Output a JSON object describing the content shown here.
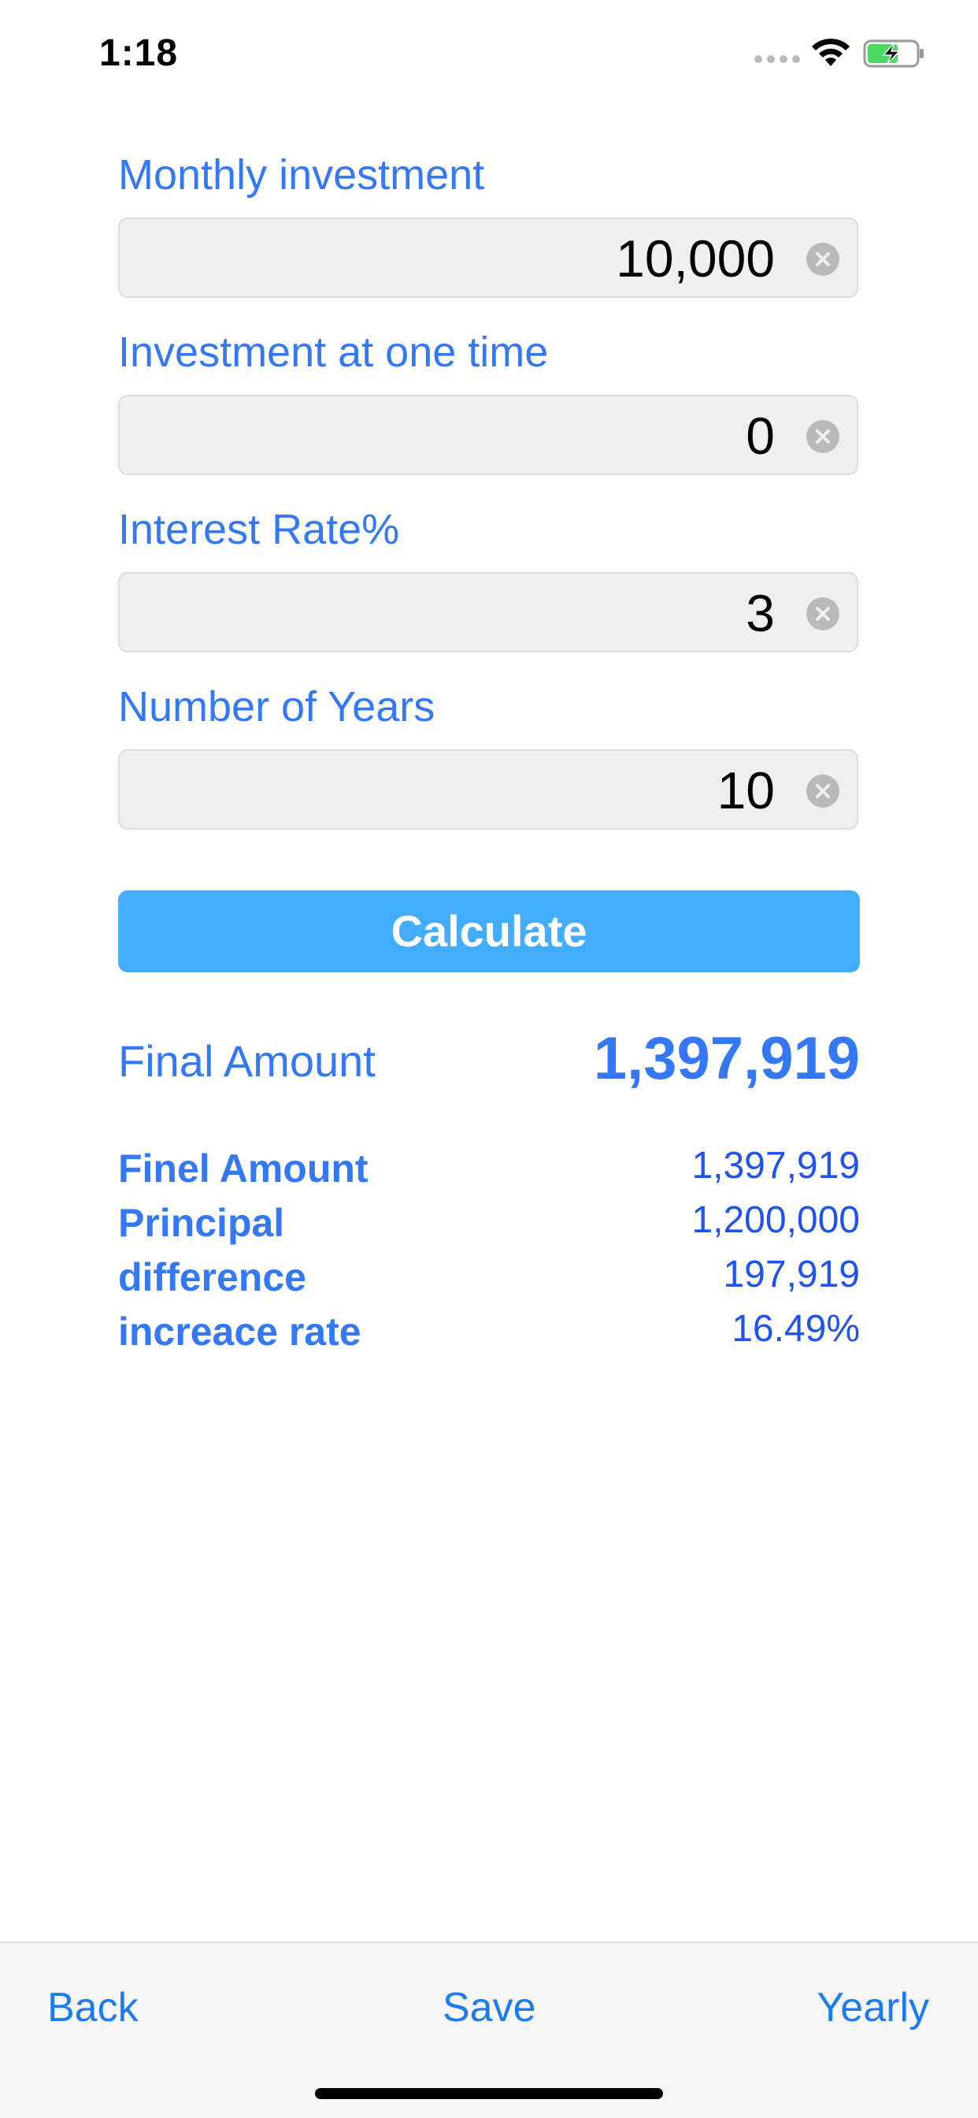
{
  "status_bar": {
    "time": "1:18"
  },
  "form": {
    "fields": [
      {
        "label": "Monthly investment",
        "value": "10,000"
      },
      {
        "label": "Investment at one time",
        "value": "0"
      },
      {
        "label": "Interest Rate%",
        "value": "3"
      },
      {
        "label": "Number of Years",
        "value": "10"
      }
    ],
    "calculate_label": "Calculate"
  },
  "result": {
    "final_label": "Final Amount",
    "final_value": "1,397,919",
    "summary": [
      {
        "label": "Finel Amount",
        "value": "1,397,919"
      },
      {
        "label": "Principal",
        "value": "1,200,000"
      },
      {
        "label": "difference",
        "value": "197,919"
      },
      {
        "label": "increace rate",
        "value": "16.49%"
      }
    ]
  },
  "toolbar": {
    "back_label": "Back",
    "save_label": "Save",
    "yearly_label": "Yearly"
  },
  "icons": {
    "wifi": "wifi-icon",
    "battery": "battery-charging-icon",
    "clear": "clear-circle-icon"
  },
  "colors": {
    "accent": "#3478f6",
    "button": "#43adfc",
    "toolbar_text": "#1a7cf0",
    "input_bg": "#efefef"
  }
}
